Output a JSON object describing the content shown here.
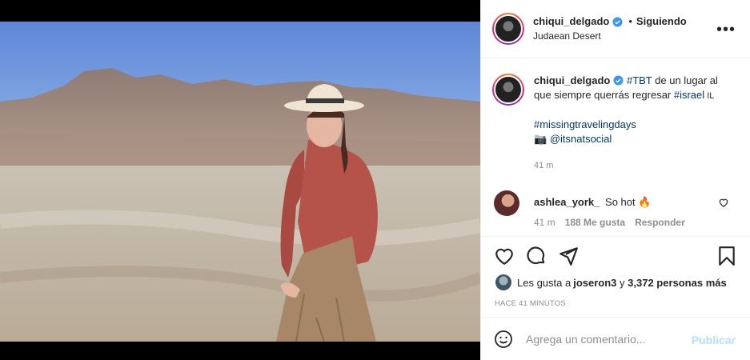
{
  "post": {
    "username": "chiqui_delgado",
    "follow_dot": "•",
    "follow_label": "Siguiendo",
    "location": "Judaean Desert",
    "more_label": "•••"
  },
  "caption": {
    "username": "chiqui_delgado",
    "hashtag1": "#TBT",
    "text1": " de un lugar al que siempre querrás regresar ",
    "hashtag2": "#israel",
    "flag": " IL",
    "hashtag3": "#missingtravelingdays",
    "camera": "📷 ",
    "mention": "@itsnatsocial",
    "time": "41 m"
  },
  "reply": {
    "username": "ashlea_york_",
    "text": "So hot 🔥",
    "time": "41 m",
    "likes": "188 Me gusta",
    "reply_label": "Responder"
  },
  "likes": {
    "prefix": "Les gusta a ",
    "user": "joseron3",
    "mid": " y ",
    "count": "3,372 personas más"
  },
  "time_ago": "HACE 41 MINUTOS",
  "comment_box": {
    "placeholder": "Agrega un comentario...",
    "publish_label": "Publicar"
  },
  "colors": {
    "link": "#00376b",
    "verified": "#3897f0",
    "publish_disabled": "#b2dffc",
    "muted": "#8e8e8e"
  },
  "icons": [
    "verified-icon",
    "more-options-icon",
    "heart-icon",
    "comment-icon",
    "share-icon",
    "save-icon",
    "emoji-icon"
  ]
}
